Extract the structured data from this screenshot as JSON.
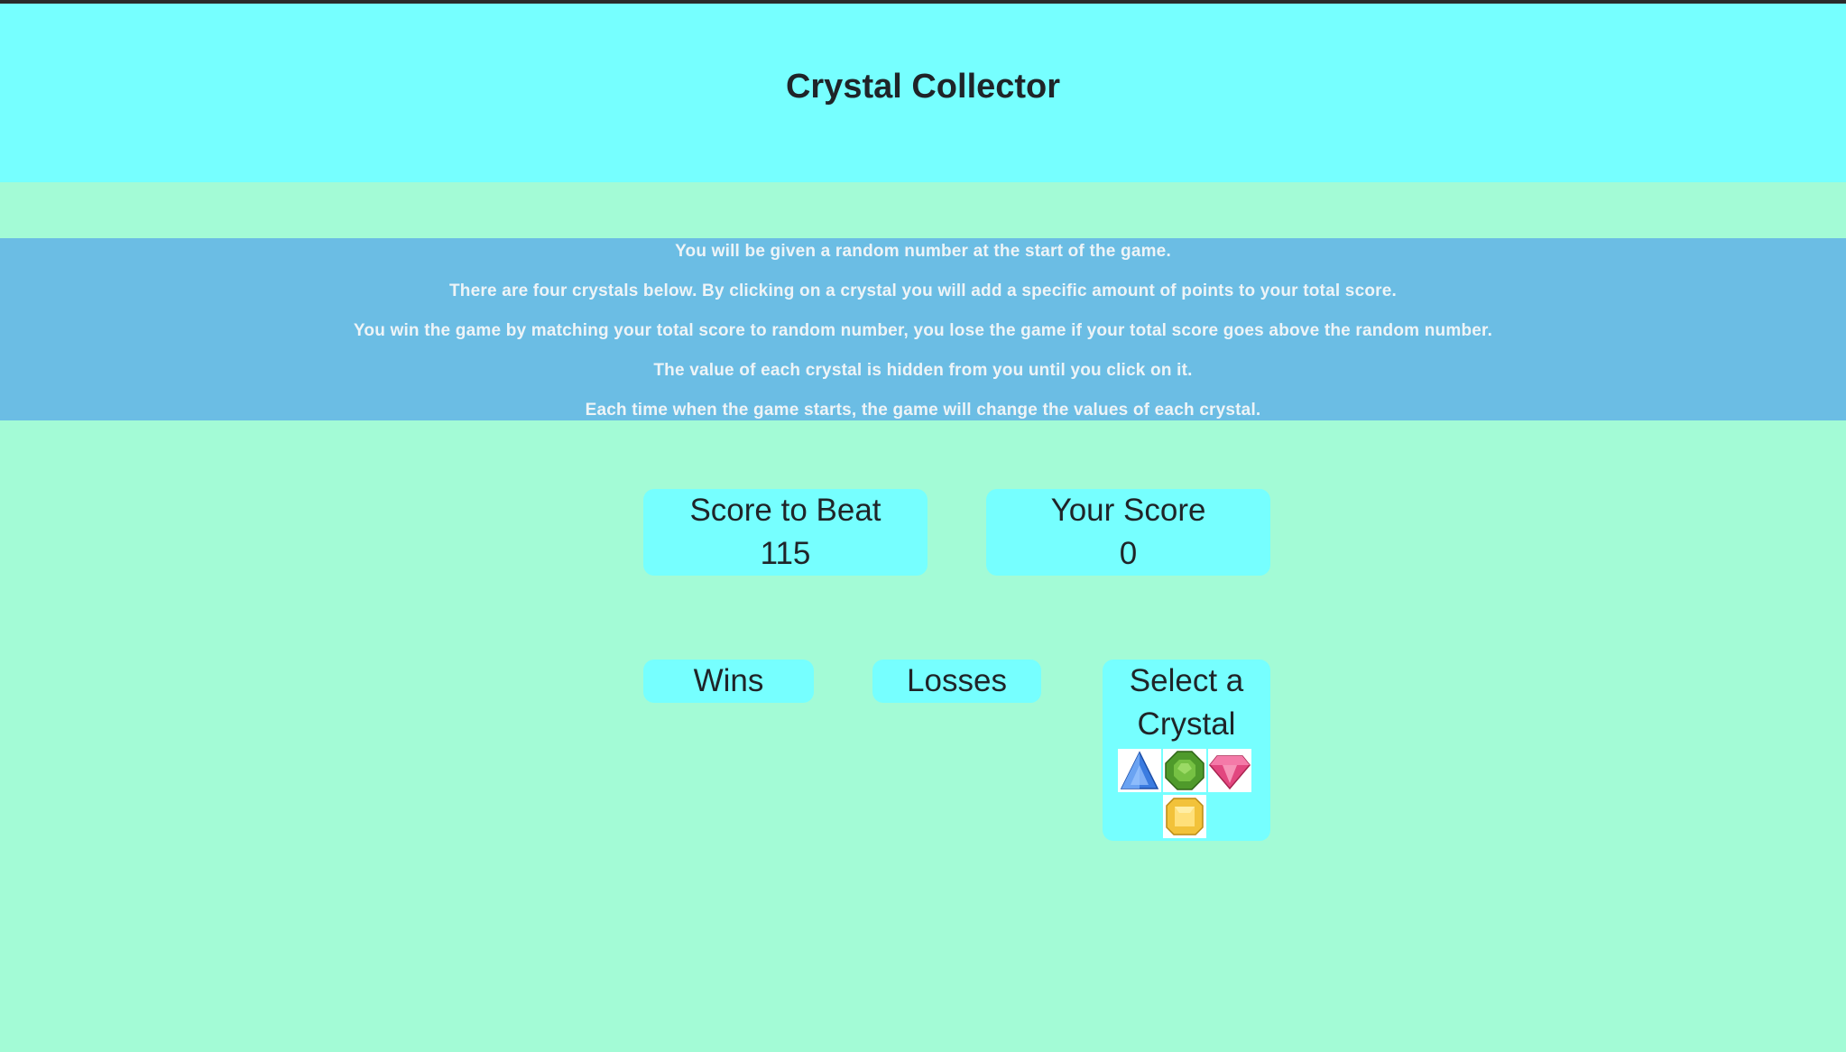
{
  "header": {
    "title": "Crystal Collector"
  },
  "instructions": [
    "You will be given a random number at the start of the game.",
    "There are four crystals below. By clicking on a crystal you will add a specific amount of points to your total score.",
    "You win the game by matching your total score to random number, you lose the game if your total score goes above the random number.",
    "The value of each crystal is hidden from you until you click on it.",
    "Each time when the game starts, the game will change the values of each crystal."
  ],
  "scoreboard": {
    "target": {
      "label": "Score to Beat",
      "value": "115"
    },
    "player": {
      "label": "Your Score",
      "value": "0"
    }
  },
  "tally": {
    "wins_label": "Wins",
    "losses_label": "Losses"
  },
  "crystals": {
    "label": "Select a Crystal",
    "items": [
      {
        "name": "blue-crystal-icon",
        "color": "#3b7be0"
      },
      {
        "name": "green-crystal-icon",
        "color": "#4f9a2b"
      },
      {
        "name": "pink-crystal-icon",
        "color": "#e2467f"
      },
      {
        "name": "yellow-crystal-icon",
        "color": "#f2c23a"
      }
    ]
  },
  "colors": {
    "header_bg": "#76ffff",
    "page_bg": "#a3fbd6",
    "instructions_bg": "#6bbde4",
    "box_bg": "#76ffff"
  }
}
